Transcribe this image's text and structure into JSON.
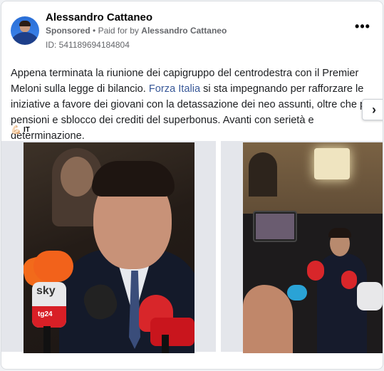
{
  "post": {
    "author": "Alessandro Cattaneo",
    "sponsored_label": "Sponsored",
    "separator": "•",
    "paid_for_prefix": "Paid for by",
    "paid_for_name": "Alessandro Cattaneo",
    "ad_id": "ID: 541189694184804",
    "more_label": "•••",
    "text_part1": "Appena terminata la riunione dei capigruppo del centrodestra con il Premier Meloni sulla legge di bilancio. ",
    "text_link": "Forza Italia",
    "text_part2": " si sta impegnando per rafforzare le iniziative a favore dei giovani con la detassazione dei neo assunti, oltre che per pensioni e sblocco dei crediti del superbonus. Avanti con serietà e determinazione.",
    "text_emoji": "💪🏻",
    "language_badge": "IT",
    "mic_brand_sky": "sky",
    "mic_brand_tg24": "tg24"
  },
  "carousel": {
    "next_label": "›",
    "icons": {
      "next": "chevron-right-icon",
      "more": "more-options-icon"
    }
  },
  "colors": {
    "link": "#385898",
    "secondary_text": "#65676b",
    "primary_text": "#1c1e21"
  }
}
